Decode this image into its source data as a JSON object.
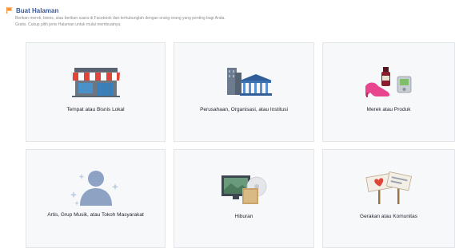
{
  "header": {
    "title": "Buat Halaman",
    "description_line1": "Berikan merek, bisnis, atau berikan suara di Facebook dan terhubunglah dengan orang-orang yang penting bagi Anda.",
    "description_line2": "Gratis. Cukup pilih jenis Halaman untuk mulai membuatnya."
  },
  "categories": [
    {
      "label": "Tempat atau Bisnis Lokal",
      "icon": "storefront-icon"
    },
    {
      "label": "Perusahaan, Organisasi, atau Institusi",
      "icon": "buildings-icon"
    },
    {
      "label": "Merek atau Produk",
      "icon": "brand-products-icon"
    },
    {
      "label": "Artis, Grup Musik, atau Tokoh Masyarakat",
      "icon": "public-figure-icon"
    },
    {
      "label": "Hiburan",
      "icon": "entertainment-icon"
    },
    {
      "label": "Gerakan atau Komunitas",
      "icon": "cause-community-icon"
    }
  ],
  "colors": {
    "accent": "#3b5998",
    "card_bg": "#f7f8fa",
    "card_border": "#e3e5e9",
    "flag": "#f7923a"
  }
}
